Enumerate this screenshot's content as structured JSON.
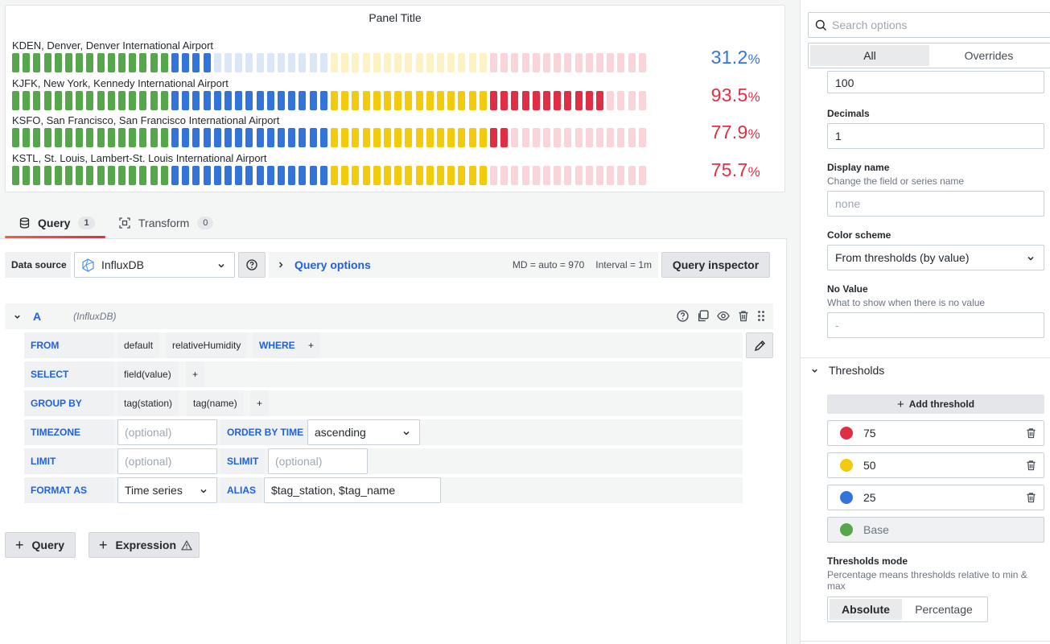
{
  "panel": {
    "title": "Panel Title",
    "gauges": [
      {
        "name": "KDEN, Denver, Denver International Airport",
        "value": "31.2",
        "unit": "%",
        "fraction": 0.312,
        "color": "#3274d9"
      },
      {
        "name": "KJFK, New York, Kennedy International Airport",
        "value": "93.5",
        "unit": "%",
        "fraction": 0.935,
        "color": "#e02f44"
      },
      {
        "name": "KSFO, San Francisco, San Francisco International Airport",
        "value": "77.9",
        "unit": "%",
        "fraction": 0.779,
        "color": "#e02f44"
      },
      {
        "name": "KSTL, St. Louis, Lambert-St. Louis International Airport",
        "value": "75.7",
        "unit": "%",
        "fraction": 0.757,
        "color": "#e02f44"
      }
    ],
    "colors": {
      "green_on": "#56a64b",
      "green_off": "#d2e8cd",
      "blue_on": "#3274d9",
      "blue_off": "#dbe6f7",
      "yellow_on": "#f2cc0c",
      "yellow_off": "#fcf2c2",
      "red_on": "#e02f44",
      "red_off": "#f9d5da"
    }
  },
  "tabs": [
    {
      "label": "Query",
      "count": "1",
      "icon": "database-icon",
      "active": true
    },
    {
      "label": "Transform",
      "count": "0",
      "icon": "transform-icon",
      "active": false
    }
  ],
  "datasource": {
    "label": "Data source",
    "value": "InfluxDB",
    "query_options_label": "Query options",
    "md": "MD = auto = 970",
    "interval": "Interval = 1m",
    "inspector_label": "Query inspector"
  },
  "query": {
    "ref_id": "A",
    "ds_name": "(InfluxDB)",
    "from": {
      "keyword": "FROM",
      "policy": "default",
      "measurement": "relativeHumidity",
      "where": "WHERE",
      "plus": "+"
    },
    "select": {
      "keyword": "SELECT",
      "field": "field(value)",
      "plus": "+"
    },
    "group_by": {
      "keyword": "GROUP BY",
      "tag1": "tag(station)",
      "tag2": "tag(name)",
      "plus": "+"
    },
    "timezone": {
      "keyword": "TIMEZONE",
      "placeholder": "(optional)",
      "order_label": "ORDER BY TIME",
      "order_value": "ascending"
    },
    "limit": {
      "keyword": "LIMIT",
      "placeholder": "(optional)",
      "slimit_label": "SLIMIT",
      "slimit_placeholder": "(optional)"
    },
    "format": {
      "keyword": "FORMAT AS",
      "value": "Time series",
      "alias_label": "ALIAS",
      "alias_value": "$tag_station, $tag_name"
    }
  },
  "add_buttons": {
    "query": "Query",
    "expression": "Expression"
  },
  "options": {
    "search_placeholder": "Search options",
    "tabs": [
      "All",
      "Overrides"
    ],
    "max_value": "100",
    "decimals_label": "Decimals",
    "decimals_value": "1",
    "display_name_label": "Display name",
    "display_name_desc": "Change the field or series name",
    "display_name_placeholder": "none",
    "color_scheme_label": "Color scheme",
    "color_scheme_value": "From thresholds (by value)",
    "no_value_label": "No Value",
    "no_value_desc": "What to show when there is no value",
    "no_value_placeholder": "-",
    "thresholds_title": "Thresholds",
    "add_threshold_label": "Add threshold",
    "thresholds": [
      {
        "value": "75",
        "color": "#e02f44"
      },
      {
        "value": "50",
        "color": "#f2cc0c"
      },
      {
        "value": "25",
        "color": "#3274d9"
      },
      {
        "value": "Base",
        "color": "#56a64b"
      }
    ],
    "thresholds_mode_label": "Thresholds mode",
    "thresholds_mode_desc": "Percentage means thresholds relative to min & max",
    "modes": [
      "Absolute",
      "Percentage"
    ]
  }
}
